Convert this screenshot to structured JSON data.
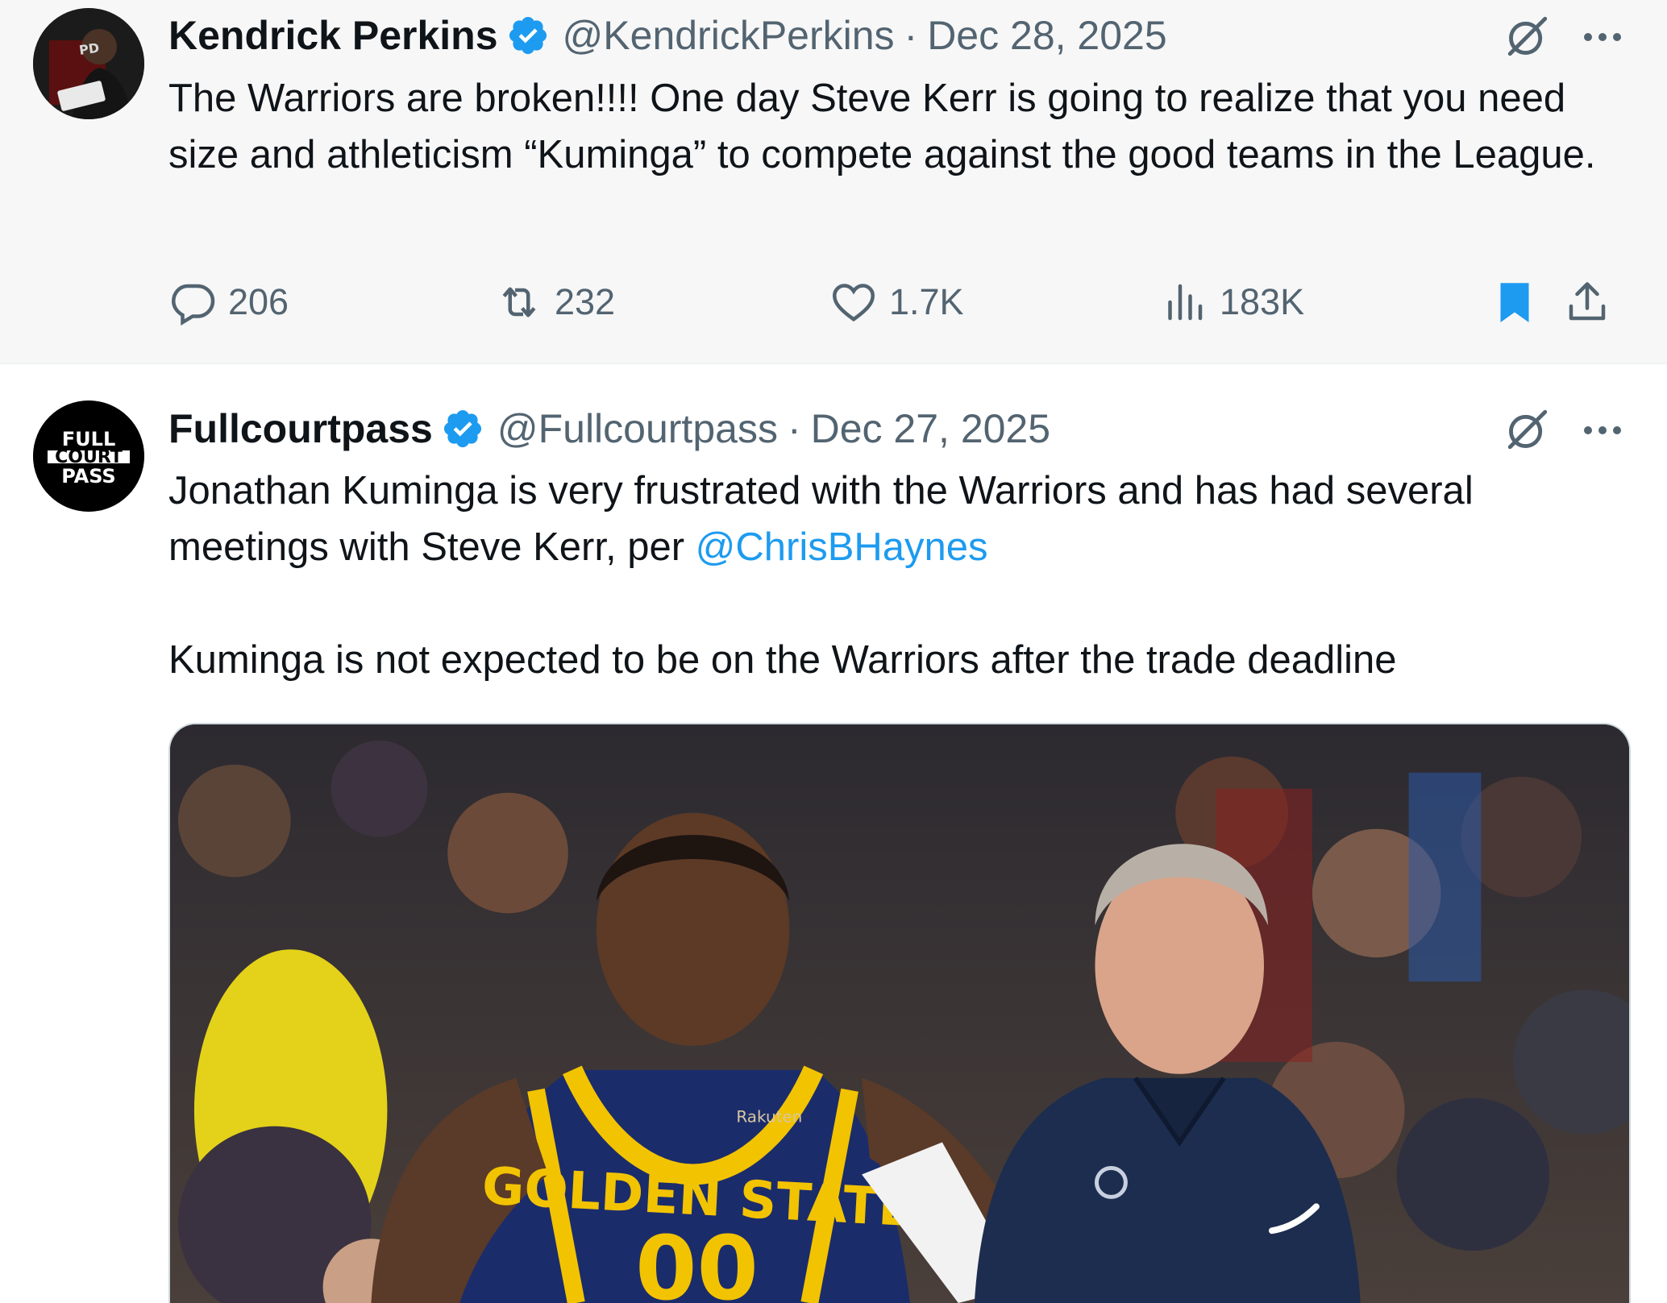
{
  "tweets": [
    {
      "author": {
        "display_name": "Kendrick Perkins",
        "handle": "@KendrickPerkins",
        "verified": true
      },
      "separator": "·",
      "date": "Dec 28, 2025",
      "text": "The Warriors are broken!!!! One day Steve Kerr is going to realize that you need size and athleticism “Kuminga” to compete against the good teams in the League.",
      "actions": {
        "replies": "206",
        "reposts": "232",
        "likes": "1.7K",
        "views": "183K",
        "bookmarked": true
      }
    },
    {
      "author": {
        "display_name": "Fullcourtpass",
        "handle": "@Fullcourtpass",
        "verified": true,
        "avatar_text": [
          "FULL",
          "COURT",
          "PASS"
        ]
      },
      "separator": "·",
      "date": "Dec 27, 2025",
      "text_part1": "Jonathan Kuminga is very frustrated with the Warriors and has had several meetings with Steve Kerr, per ",
      "mention": "@ChrisBHaynes",
      "text_part2": "Kuminga is not expected to be on the Warriors after the trade deadline",
      "media": {
        "jersey_text": "GOLDEN STATE",
        "jersey_number": "00",
        "sponsor": "Rakuten"
      }
    }
  ],
  "icons": [
    "grok-icon",
    "more-icon",
    "verified-badge-icon",
    "reply-icon",
    "repost-icon",
    "like-icon",
    "views-icon",
    "bookmark-icon",
    "share-icon"
  ],
  "colors": {
    "verified": "#1d9bf0",
    "link": "#1d9bf0",
    "muted": "#536471",
    "text": "#0f1419",
    "highlight_bg": "#f7f7f7"
  }
}
